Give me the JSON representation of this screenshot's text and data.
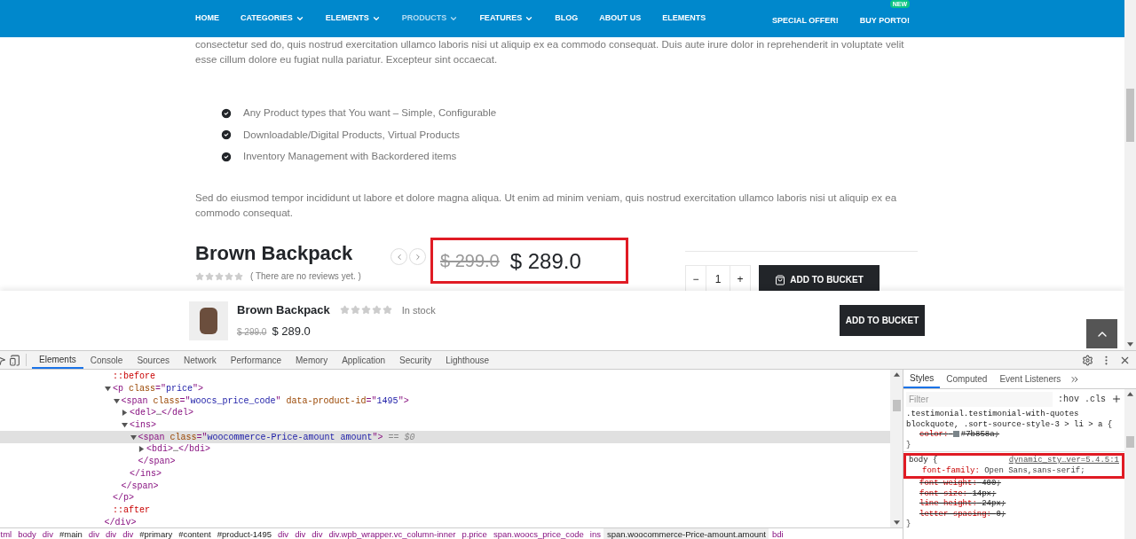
{
  "nav": {
    "items": [
      {
        "label": "HOME",
        "selected": false,
        "dropdown": false
      },
      {
        "label": "CATEGORIES",
        "selected": false,
        "dropdown": true
      },
      {
        "label": "ELEMENTS",
        "selected": false,
        "dropdown": true
      },
      {
        "label": "PRODUCTS",
        "selected": true,
        "dropdown": true
      },
      {
        "label": "FEATURES",
        "selected": false,
        "dropdown": true
      },
      {
        "label": "BLOG",
        "selected": false,
        "dropdown": false
      },
      {
        "label": "ABOUT US",
        "selected": false,
        "dropdown": false
      },
      {
        "label": "ELEMENTS",
        "selected": false,
        "dropdown": false
      }
    ],
    "right_items": [
      {
        "label": "SPECIAL OFFER!"
      },
      {
        "label": "BUY PORTO!",
        "badge": "NEW"
      }
    ]
  },
  "page": {
    "intro": "consectetur sed do, quis nostrud exercitation ullamco laboris nisi ut aliquip ex ea commodo consequat. Duis aute irure dolor in reprehenderit in voluptate velit esse cillum dolore eu fugiat nulla pariatur. Excepteur sint occaecat.",
    "features": [
      "Any Product types that You want – Simple, Configurable",
      "Downloadable/Digital Products, Virtual Products",
      "Inventory Management with Backordered items"
    ],
    "paragraph": "Sed do eiusmod tempor incididunt ut labore et dolore magna aliqua. Ut enim ad minim veniam, quis nostrud exercitation ullamco laboris nisi ut aliquip ex ea commodo consequat.",
    "product": {
      "title": "Brown Backpack",
      "stars": 0,
      "reviews": "( There are no reviews yet. )",
      "old_price": "$ 299.0",
      "price": "$ 289.0",
      "quantity": "1",
      "minus": "−",
      "plus": "+",
      "add_button": "ADD TO BUCKET"
    }
  },
  "sticky_bar": {
    "title": "Brown Backpack",
    "stars": 0,
    "stock": "In stock",
    "old_price": "$ 299.0",
    "price": "$ 289.0",
    "add_button": "ADD TO BUCKET"
  },
  "devtools": {
    "tabs": [
      {
        "label": "Elements",
        "selected": true
      },
      {
        "label": "Console",
        "selected": false
      },
      {
        "label": "Sources",
        "selected": false
      },
      {
        "label": "Network",
        "selected": false
      },
      {
        "label": "Performance",
        "selected": false
      },
      {
        "label": "Memory",
        "selected": false
      },
      {
        "label": "Application",
        "selected": false
      },
      {
        "label": "Security",
        "selected": false
      },
      {
        "label": "Lighthouse",
        "selected": false
      }
    ],
    "dom": [
      {
        "children": [
          {
            "parts": [
              {
                "kind": "pseudo",
                "text": "::before"
              }
            ]
          },
          {
            "parts": [
              {
                "kind": "tag",
                "text": "<p "
              },
              {
                "kind": "attr",
                "text": "class"
              },
              {
                "kind": "tag",
                "text": "=\""
              },
              {
                "kind": "value",
                "text": "price"
              },
              {
                "kind": "tag",
                "text": "\">"
              }
            ],
            "expanded": true,
            "selected": false,
            "children": [
              {
                "parts": [
                  {
                    "kind": "tag",
                    "text": "<span "
                  },
                  {
                    "kind": "attr",
                    "text": "class"
                  },
                  {
                    "kind": "tag",
                    "text": "=\""
                  },
                  {
                    "kind": "value",
                    "text": "woocs_price_code"
                  },
                  {
                    "kind": "tag",
                    "text": "\" "
                  },
                  {
                    "kind": "attr",
                    "text": "data-product-id"
                  },
                  {
                    "kind": "tag",
                    "text": "=\""
                  },
                  {
                    "kind": "value",
                    "text": "1495"
                  },
                  {
                    "kind": "tag",
                    "text": "\">"
                  }
                ],
                "expanded": true,
                "selected": false,
                "children": [
                  {
                    "parts": [
                      {
                        "kind": "tag",
                        "text": "<del>"
                      },
                      {
                        "kind": "text",
                        "text": "…"
                      },
                      {
                        "kind": "tag",
                        "text": "</del>"
                      }
                    ],
                    "expanded": false,
                    "selected": false
                  },
                  {
                    "parts": [
                      {
                        "kind": "tag",
                        "text": "<ins>"
                      }
                    ],
                    "expanded": true,
                    "selected": false,
                    "children": [
                      {
                        "parts": [
                          {
                            "kind": "tag",
                            "text": "<span "
                          },
                          {
                            "kind": "attr",
                            "text": "class"
                          },
                          {
                            "kind": "tag",
                            "text": "=\""
                          },
                          {
                            "kind": "value",
                            "text": "woocommerce-Price-amount amount"
                          },
                          {
                            "kind": "tag",
                            "text": "\">"
                          },
                          {
                            "kind": "note",
                            "text": " == $0"
                          }
                        ],
                        "expanded": true,
                        "selected": true,
                        "children": [
                          {
                            "parts": [
                              {
                                "kind": "tag",
                                "text": "<bdi>"
                              },
                              {
                                "kind": "text",
                                "text": "…"
                              },
                              {
                                "kind": "tag",
                                "text": "</bdi>"
                              }
                            ],
                            "expanded": false,
                            "selected": false
                          }
                        ],
                        "close": [
                          {
                            "kind": "tag",
                            "text": "</span>"
                          }
                        ]
                      }
                    ],
                    "close": [
                      {
                        "kind": "tag",
                        "text": "</ins>"
                      }
                    ]
                  }
                ],
                "close": [
                  {
                    "kind": "tag",
                    "text": "</span>"
                  }
                ]
              }
            ],
            "close": [
              {
                "kind": "tag",
                "text": "</p>"
              }
            ]
          },
          {
            "parts": [
              {
                "kind": "pseudo",
                "text": "::after"
              }
            ]
          }
        ],
        "close": [
          {
            "kind": "tag",
            "text": "</div>"
          }
        ]
      }
    ],
    "breadcrumbs": [
      {
        "label": "tml",
        "selected": false
      },
      {
        "label": "body",
        "selected": false
      },
      {
        "label": "div",
        "selected": false
      },
      {
        "label": "#main",
        "selected": false
      },
      {
        "label": "div",
        "selected": false
      },
      {
        "label": "div",
        "selected": false
      },
      {
        "label": "div",
        "selected": false
      },
      {
        "label": "#primary",
        "selected": false
      },
      {
        "label": "#content",
        "selected": false
      },
      {
        "label": "#product-1495",
        "selected": false
      },
      {
        "label": "div",
        "selected": false
      },
      {
        "label": "div",
        "selected": false
      },
      {
        "label": "div",
        "selected": false
      },
      {
        "label": "div.wpb_wrapper.vc_column-inner",
        "selected": false
      },
      {
        "label": "p.price",
        "selected": false
      },
      {
        "label": "span.woocs_price_code",
        "selected": false
      },
      {
        "label": "ins",
        "selected": false
      },
      {
        "label": "span.woocommerce-Price-amount.amount",
        "selected": true
      },
      {
        "label": "bdi",
        "selected": false
      }
    ],
    "styles_tabs": [
      {
        "label": "Styles",
        "selected": true
      },
      {
        "label": "Computed",
        "selected": false
      },
      {
        "label": "Event Listeners",
        "selected": false
      }
    ],
    "filter": {
      "placeholder": "Filter"
    },
    "hov": ":hov",
    "cls": ".cls",
    "rules": [
      {
        "selector": ".testimonial.testimonial-with-quotes blockquote, .sort-source-style-3 > li > a {",
        "decls": [
          {
            "property": "color:",
            "value": "#7b858a;",
            "overridden": true,
            "swatch": true
          }
        ],
        "close": "}"
      },
      {
        "selector": "body {",
        "source": "dynamic_sty…ver=5.4.5:1",
        "highlighted": true,
        "decls": [
          {
            "property": "font-family:",
            "value": "Open Sans,sans-serif;",
            "overridden": false
          },
          {
            "property": "font-weight:",
            "value": "400;",
            "overridden": true
          },
          {
            "property": "font-size:",
            "value": "14px;",
            "overridden": true
          },
          {
            "property": "line-height:",
            "value": "24px;",
            "overridden": true
          },
          {
            "property": "letter-spacing:",
            "value": "0;",
            "overridden": true
          }
        ],
        "close": "}"
      }
    ]
  }
}
